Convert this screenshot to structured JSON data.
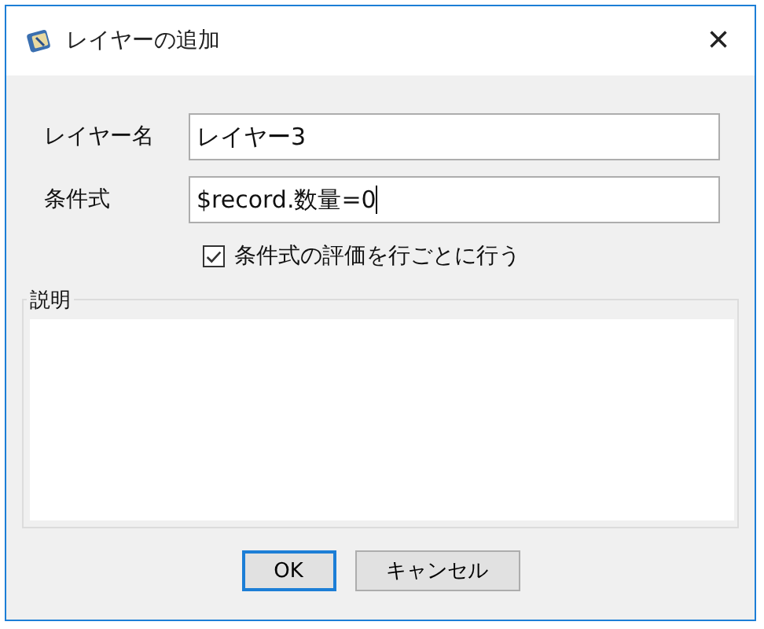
{
  "window": {
    "title": "レイヤーの追加",
    "close": "×"
  },
  "fields": [
    {
      "label": "レイヤー名",
      "value": "レイヤー3"
    },
    {
      "label": "条件式",
      "value": "$record.数量=0"
    }
  ],
  "option": {
    "label": "条件式の評価を行ごとに行う",
    "checked": true
  },
  "description": {
    "label": "説明"
  },
  "buttons": [
    {
      "label": "OK",
      "default": true
    },
    {
      "label": "キャンセル",
      "default": false
    }
  ]
}
